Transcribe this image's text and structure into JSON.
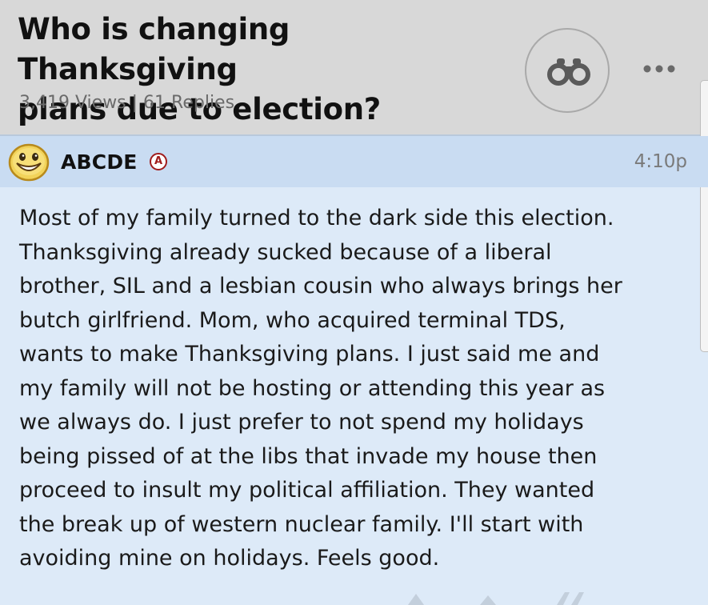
{
  "thread": {
    "title_line1": "Who is changing Thanksgiving",
    "title_line2": "plans due to election?",
    "stats": "3,419 Views | 61 Replies"
  },
  "icons": {
    "watch": "binoculars-icon",
    "more": "more-dots-icon",
    "avatar": "smiley-face-icon"
  },
  "post": {
    "username": "ABCDE",
    "badge": "A",
    "time": "4:10p",
    "body_lines": [
      "Most of my family turned to the dark side this election.",
      "Thanksgiving already sucked because of a liberal",
      "brother, SIL and a lesbian cousin who always brings her",
      "butch girlfriend. Mom, who acquired terminal TDS,",
      "wants to make Thanksgiving plans. I just said me and",
      "my family will not be hosting or attending this year as",
      "we always do. I just prefer to not spend my holidays",
      "being pissed of at the libs that invade my house then",
      "proceed to insult my political affiliation. They wanted",
      "the break up of western nuclear family. I'll start with",
      "avoiding mine on holidays. Feels good."
    ]
  },
  "colors": {
    "header_bg": "#d8d8d8",
    "post_header_bg": "#c9dcf2",
    "post_bg": "#ddeaf8",
    "badge": "#a01c1c"
  }
}
